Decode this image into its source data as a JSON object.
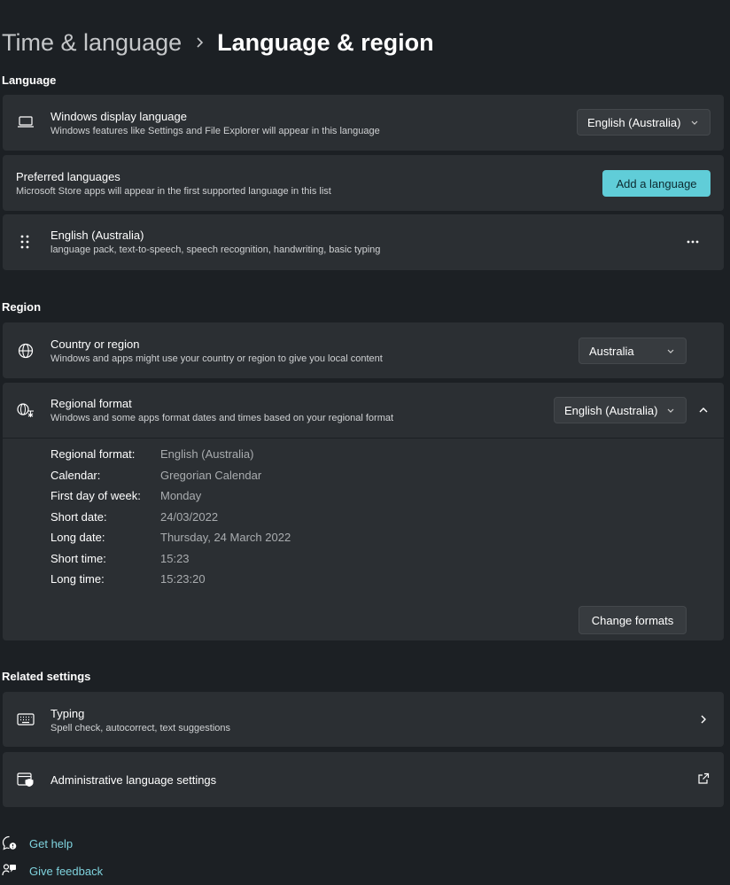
{
  "breadcrumb": {
    "parent": "Time & language",
    "current": "Language & region"
  },
  "language_section": {
    "heading": "Language",
    "display_language": {
      "title": "Windows display language",
      "subtitle": "Windows features like Settings and File Explorer will appear in this language",
      "value": "English (Australia)"
    },
    "preferred": {
      "title": "Preferred languages",
      "subtitle": "Microsoft Store apps will appear in the first supported language in this list",
      "add_button": "Add a language"
    },
    "installed": {
      "title": "English (Australia)",
      "subtitle": "language pack, text-to-speech, speech recognition, handwriting, basic typing"
    }
  },
  "region_section": {
    "heading": "Region",
    "country": {
      "title": "Country or region",
      "subtitle": "Windows and apps might use your country or region to give you local content",
      "value": "Australia"
    },
    "format": {
      "title": "Regional format",
      "subtitle": "Windows and some apps format dates and times based on your regional format",
      "value": "English (Australia)",
      "rows": [
        {
          "label": "Regional format:",
          "value": "English (Australia)"
        },
        {
          "label": "Calendar:",
          "value": "Gregorian Calendar"
        },
        {
          "label": "First day of week:",
          "value": "Monday"
        },
        {
          "label": "Short date:",
          "value": "24/03/2022"
        },
        {
          "label": "Long date:",
          "value": "Thursday, 24 March 2022"
        },
        {
          "label": "Short time:",
          "value": "15:23"
        },
        {
          "label": "Long time:",
          "value": "15:23:20"
        }
      ],
      "change_button": "Change formats"
    }
  },
  "related_section": {
    "heading": "Related settings",
    "typing": {
      "title": "Typing",
      "subtitle": "Spell check, autocorrect, text suggestions"
    },
    "admin": {
      "title": "Administrative language settings"
    }
  },
  "footer": {
    "help": "Get help",
    "feedback": "Give feedback"
  },
  "colors": {
    "background": "#1c2024",
    "card": "#2b2f33",
    "accent": "#60cdd8",
    "link": "#7fd3de"
  }
}
